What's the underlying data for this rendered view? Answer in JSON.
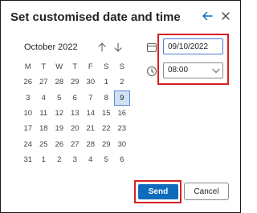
{
  "dialog": {
    "title": "Set customised date and time"
  },
  "calendar": {
    "month_label": "October 2022",
    "weekdays": [
      "M",
      "T",
      "W",
      "T",
      "F",
      "S",
      "S"
    ],
    "weeks": [
      [
        "26",
        "27",
        "28",
        "29",
        "30",
        "1",
        "2"
      ],
      [
        "3",
        "4",
        "5",
        "6",
        "7",
        "8",
        "9"
      ],
      [
        "10",
        "11",
        "12",
        "13",
        "14",
        "15",
        "16"
      ],
      [
        "17",
        "18",
        "19",
        "20",
        "21",
        "22",
        "23"
      ],
      [
        "24",
        "25",
        "26",
        "27",
        "28",
        "29",
        "30"
      ],
      [
        "31",
        "1",
        "2",
        "3",
        "4",
        "5",
        "6"
      ]
    ],
    "selected_day": "9"
  },
  "date_input": {
    "value": "09/10/2022"
  },
  "time_select": {
    "value": "08:00"
  },
  "actions": {
    "send_label": "Send",
    "cancel_label": "Cancel"
  },
  "icons": {
    "back": "arrow-left-icon",
    "close": "close-icon",
    "prev_month": "arrow-up-icon",
    "next_month": "arrow-down-icon",
    "date": "calendar-icon",
    "time": "clock-icon",
    "dropdown": "chevron-down-icon"
  },
  "colors": {
    "accent": "#0f6cbd",
    "highlight": "#d62020",
    "selected_day_bg": "#cfe0f5"
  }
}
